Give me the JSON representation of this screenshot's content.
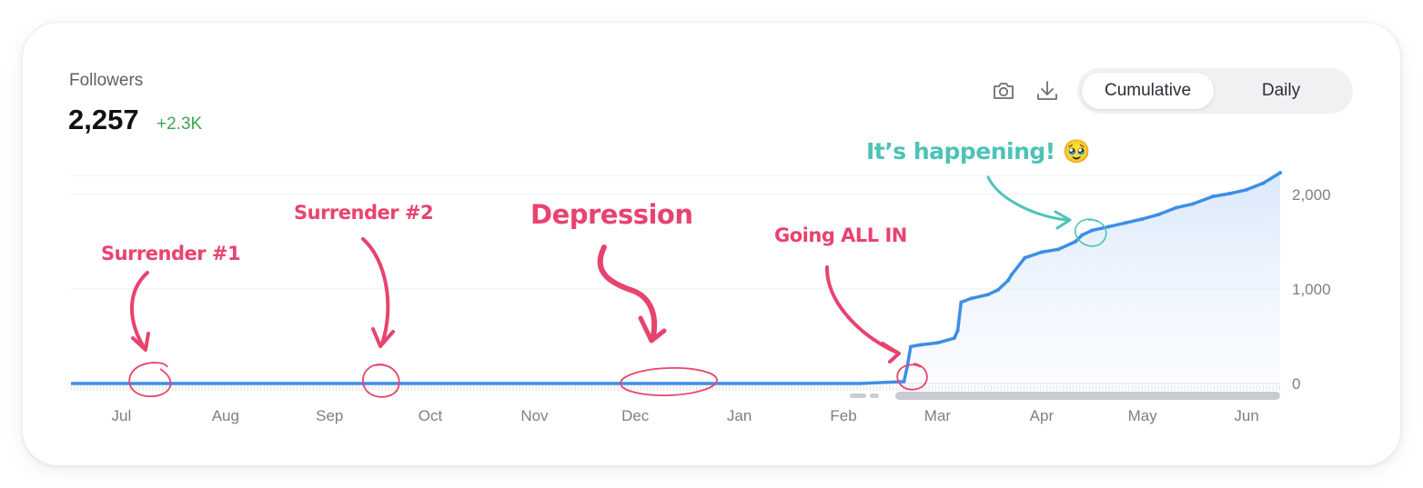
{
  "metric": {
    "label": "Followers",
    "value": "2,257",
    "delta": "+2.3K"
  },
  "toolbar": {
    "camera_icon": "camera-icon",
    "download_icon": "download-icon",
    "toggle": {
      "options": [
        "Cumulative",
        "Daily"
      ],
      "selected": "Cumulative"
    }
  },
  "colors": {
    "line": "#3d8ee6",
    "area_top": "#dbe9fb",
    "annotation": "#e8436f",
    "annotation_highlight": "#4cc3b5",
    "delta": "#3fa552"
  },
  "annotations": {
    "surrender1": "Surrender #1",
    "surrender2": "Surrender #2",
    "depression": "Depression",
    "going_all_in": "Going ALL IN",
    "happening": "It’s happening! 🥹"
  },
  "chart_data": {
    "type": "area",
    "title": "",
    "xlabel": "",
    "ylabel": "",
    "x_ticks": [
      "Jul",
      "Aug",
      "Sep",
      "Oct",
      "Nov",
      "Dec",
      "Jan",
      "Feb",
      "Mar",
      "Apr",
      "May",
      "Jun"
    ],
    "y_ticks": [
      "0",
      "1,000",
      "2,000"
    ],
    "ylim": [
      0,
      2200
    ],
    "grid": true,
    "series": [
      {
        "name": "",
        "x": [
          "2022-06-25",
          "2022-07-15",
          "2022-08-15",
          "2022-09-15",
          "2022-10-15",
          "2022-11-15",
          "2022-12-15",
          "2023-01-15",
          "2023-02-15",
          "2023-02-28",
          "2023-03-01",
          "2023-03-02",
          "2023-03-05",
          "2023-03-10",
          "2023-03-15",
          "2023-03-16",
          "2023-03-17",
          "2023-03-20",
          "2023-03-25",
          "2023-03-28",
          "2023-03-31",
          "2023-04-01",
          "2023-04-05",
          "2023-04-10",
          "2023-04-15",
          "2023-04-20",
          "2023-04-22",
          "2023-04-25",
          "2023-04-30",
          "2023-05-05",
          "2023-05-10",
          "2023-05-15",
          "2023-05-20",
          "2023-05-25",
          "2023-05-31",
          "2023-06-05",
          "2023-06-10",
          "2023-06-15",
          "2023-06-20"
        ],
        "y": [
          0,
          0,
          0,
          0,
          0,
          0,
          0,
          0,
          0,
          20,
          180,
          390,
          410,
          430,
          480,
          560,
          860,
          900,
          940,
          990,
          1090,
          1150,
          1330,
          1390,
          1420,
          1500,
          1570,
          1620,
          1660,
          1700,
          1740,
          1790,
          1860,
          1900,
          1980,
          2010,
          2050,
          2120,
          2230
        ]
      }
    ]
  }
}
